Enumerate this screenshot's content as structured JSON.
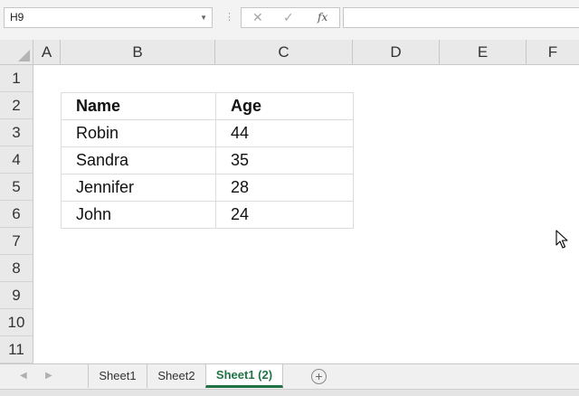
{
  "formula_bar": {
    "name_box": "H9",
    "cancel_icon": "✕",
    "enter_icon": "✓",
    "function_label": "fx",
    "formula_value": ""
  },
  "columns": [
    "A",
    "B",
    "C",
    "D",
    "E",
    "F"
  ],
  "rows": [
    "1",
    "2",
    "3",
    "4",
    "5",
    "6",
    "7",
    "8",
    "9",
    "10",
    "11"
  ],
  "table": {
    "headers": [
      "Name",
      "Age"
    ],
    "rows": [
      {
        "name": "Robin",
        "age": "44"
      },
      {
        "name": "Sandra",
        "age": "35"
      },
      {
        "name": "Jennifer",
        "age": "28"
      },
      {
        "name": "John",
        "age": "24"
      }
    ]
  },
  "sheets": {
    "tabs": [
      "Sheet1",
      "Sheet2",
      "Sheet1 (2)"
    ],
    "active": "Sheet1 (2)",
    "add_icon": "+"
  },
  "colors": {
    "active_tab": "#217346",
    "header_bg": "#e9e9e9",
    "gridline": "#dcdcdc"
  },
  "icons": [
    "dropdown-arrow-icon",
    "more-dots-icon",
    "cancel-icon",
    "enter-icon",
    "function-icon",
    "select-all-icon",
    "mouse-cursor-icon",
    "scroll-left-icon",
    "scroll-right-icon",
    "add-sheet-icon"
  ]
}
